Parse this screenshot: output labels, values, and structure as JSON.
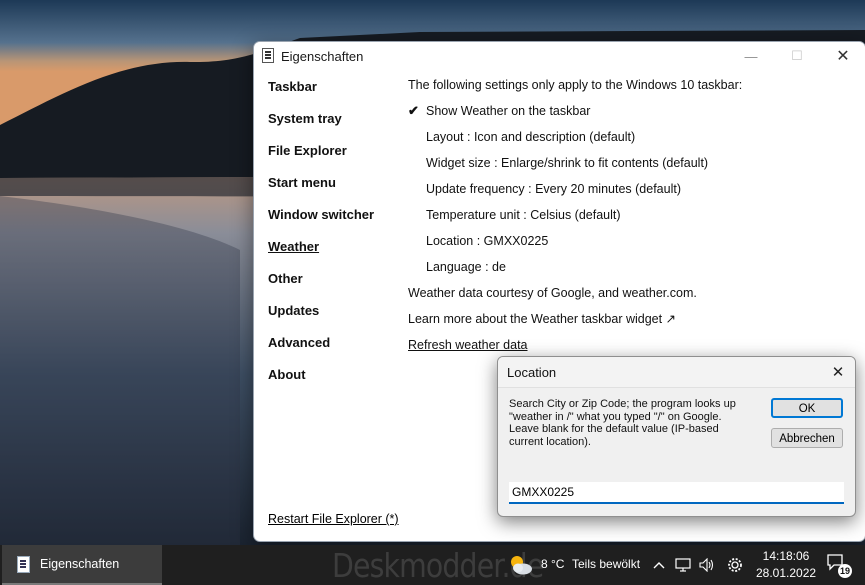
{
  "window": {
    "title": "Eigenschaften",
    "minimize_glyph": "—",
    "maximize_glyph": "☐",
    "close_glyph": "✕"
  },
  "nav": {
    "items": [
      "Taskbar",
      "System tray",
      "File Explorer",
      "Start menu",
      "Window switcher",
      "Weather",
      "Other",
      "Updates",
      "Advanced",
      "About"
    ],
    "active": "Weather"
  },
  "content": {
    "intro": "The following settings only apply to the Windows 10 taskbar:",
    "check_mark": "✔",
    "show_weather": "Show Weather on the taskbar",
    "layout": "Layout : Icon and description (default)",
    "widget_size": "Widget size : Enlarge/shrink to fit contents (default)",
    "update_frequency": "Update frequency : Every 20 minutes (default)",
    "temperature_unit": "Temperature unit : Celsius (default)",
    "location": "Location : GMXX0225",
    "language": "Language : de",
    "courtesy": "Weather data courtesy of Google, and weather.com.",
    "learn_more": "Learn more about the Weather taskbar widget ↗",
    "refresh": "Refresh weather data",
    "restart": "Restart File Explorer (*)"
  },
  "dialog": {
    "title": "Location",
    "close_glyph": "✕",
    "message": "Search City or Zip Code; the program looks up\n\"weather in /\" what you typed \"/\" on Google.\nLeave blank for the default value (IP-based\ncurrent location).",
    "ok_label": "OK",
    "cancel_label": "Abbrechen",
    "input_value": "GMXX0225"
  },
  "taskbar": {
    "app_label": "Eigenschaften",
    "watermark": "Deskmodder.de",
    "temperature": "8 °C",
    "condition": "Teils bewölkt",
    "time": "14:18:06",
    "date": "28.01.2022",
    "notification_count": "19",
    "icons": [
      "weather-icon",
      "chevron-up-icon",
      "network-icon",
      "volume-icon",
      "settings-icon",
      "notification-icon"
    ]
  }
}
